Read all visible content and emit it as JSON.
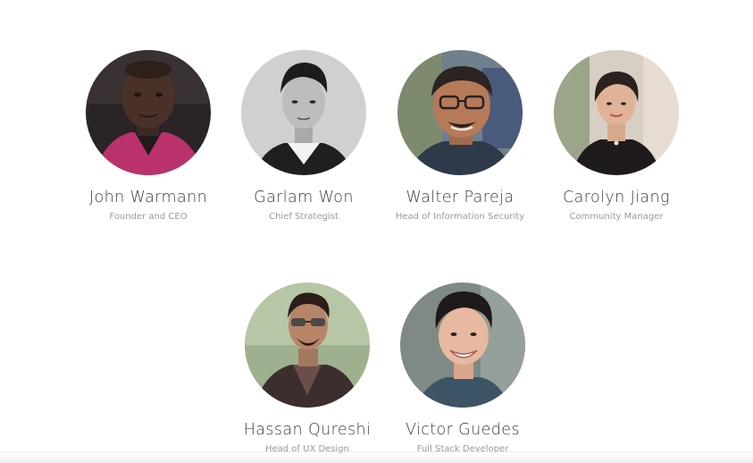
{
  "team": {
    "members": [
      {
        "name": "John Warmann",
        "role": "Founder and CEO",
        "avatar": "portrait-photo"
      },
      {
        "name": "Garlam Won",
        "role": "Chief Strategist",
        "avatar": "portrait-photo"
      },
      {
        "name": "Walter Pareja",
        "role": "Head of Information Security",
        "avatar": "portrait-photo"
      },
      {
        "name": "Carolyn Jiang",
        "role": "Community Manager",
        "avatar": "portrait-photo"
      },
      {
        "name": "Hassan Qureshi",
        "role": "Head of UX Design",
        "avatar": "portrait-photo"
      },
      {
        "name": "Victor Guedes",
        "role": "Full Stack Developer",
        "avatar": "portrait-photo"
      }
    ]
  },
  "colors": {
    "name_text": "#3d3d3d",
    "role_text": "#9a9a9a",
    "background": "#ffffff"
  }
}
